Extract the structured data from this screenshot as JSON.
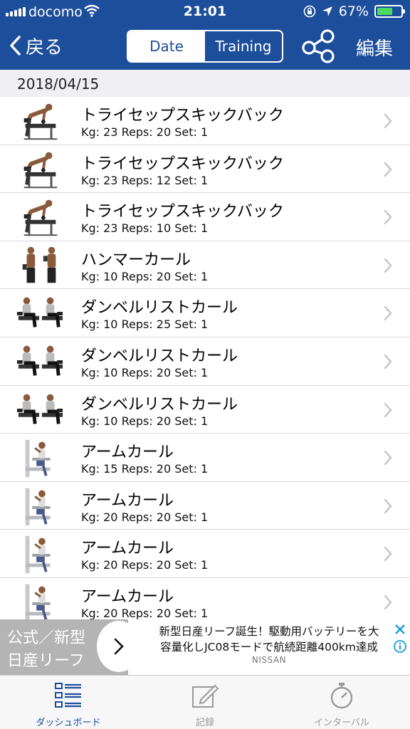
{
  "status_bar": {
    "carrier": "docomo",
    "time": "21:01",
    "battery": "67%"
  },
  "nav": {
    "back_label": "戻る",
    "segments": [
      "Date",
      "Training"
    ],
    "edit_label": "編集"
  },
  "section_date": "2018/04/15",
  "workouts": [
    {
      "name": "トライセップスキックバック",
      "detail": "Kg: 23 Reps: 20 Set: 1",
      "figure": "kickback"
    },
    {
      "name": "トライセップスキックバック",
      "detail": "Kg: 23 Reps: 12 Set: 1",
      "figure": "kickback"
    },
    {
      "name": "トライセップスキックバック",
      "detail": "Kg: 23 Reps: 10 Set: 1",
      "figure": "kickback"
    },
    {
      "name": "ハンマーカール",
      "detail": "Kg: 10 Reps: 20 Set: 1",
      "figure": "hammer"
    },
    {
      "name": "ダンベルリストカール",
      "detail": "Kg: 10 Reps: 25 Set: 1",
      "figure": "wrist"
    },
    {
      "name": "ダンベルリストカール",
      "detail": "Kg: 10 Reps: 20 Set: 1",
      "figure": "wrist"
    },
    {
      "name": "ダンベルリストカール",
      "detail": "Kg: 10 Reps: 20 Set: 1",
      "figure": "wrist"
    },
    {
      "name": "アームカール",
      "detail": "Kg: 15 Reps: 20 Set: 1",
      "figure": "machine"
    },
    {
      "name": "アームカール",
      "detail": "Kg: 20 Reps: 20 Set: 1",
      "figure": "machine"
    },
    {
      "name": "アームカール",
      "detail": "Kg: 20 Reps: 20 Set: 1",
      "figure": "machine"
    },
    {
      "name": "アームカール",
      "detail": "Kg: 20 Reps: 20 Set: 1",
      "figure": "machine"
    }
  ],
  "ad": {
    "left_line1": "公式／新型",
    "left_line2": "日産リーフ",
    "text_line1": "新型日産リーフ誕生！駆動用バッテリーを大",
    "text_line2": "容量化しJC08モードで航続距離400km達成",
    "brand": "NISSAN"
  },
  "tabs": [
    {
      "label": "ダッシュボード",
      "icon": "dashboard-icon",
      "active": true
    },
    {
      "label": "記録",
      "icon": "pencil-icon",
      "active": false
    },
    {
      "label": "インターバル",
      "icon": "stopwatch-icon",
      "active": false
    }
  ],
  "colors": {
    "nav_blue": "#1d4e9b",
    "section_bg": "#efeff4",
    "battery_green": "#4cd964"
  }
}
